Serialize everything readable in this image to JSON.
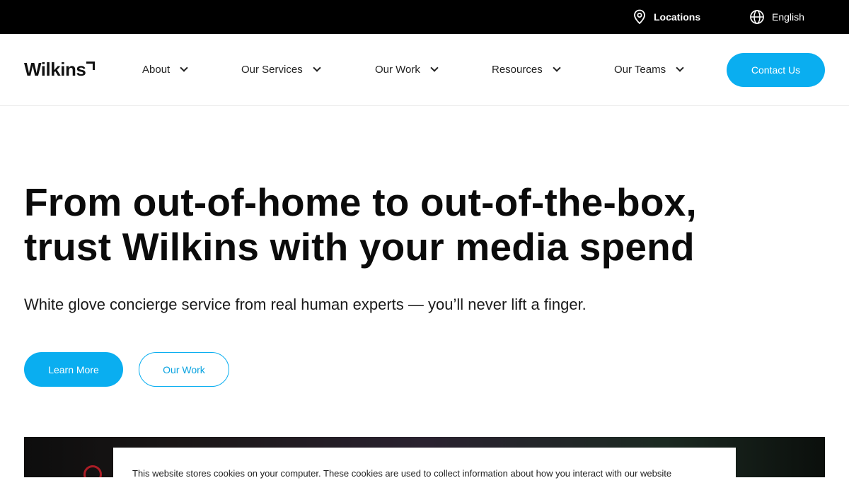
{
  "topbar": {
    "locations_label": "Locations",
    "language_label": "English"
  },
  "brand": {
    "logo_text": "Wilkins"
  },
  "nav": {
    "items": [
      {
        "label": "About"
      },
      {
        "label": "Our Services"
      },
      {
        "label": "Our Work"
      },
      {
        "label": "Resources"
      },
      {
        "label": "Our Teams"
      }
    ],
    "contact_label": "Contact Us"
  },
  "hero": {
    "title_line1": "From out-of-home to out-of-the-box,",
    "title_line2": "trust Wilkins with your media spend",
    "subtitle": "White glove concierge service from real human experts — you’ll never lift a finger.",
    "primary_button": "Learn More",
    "secondary_button": "Our Work"
  },
  "cookie_banner": {
    "text": "This website stores cookies on your computer. These cookies are used to collect information about how you interact with our website"
  },
  "colors": {
    "accent": "#0aaef0",
    "topbar_bg": "#000000",
    "text": "#111111"
  },
  "icons": {
    "locations": "map-pin-icon",
    "language": "globe-icon",
    "dropdown": "chevron-down-icon"
  }
}
